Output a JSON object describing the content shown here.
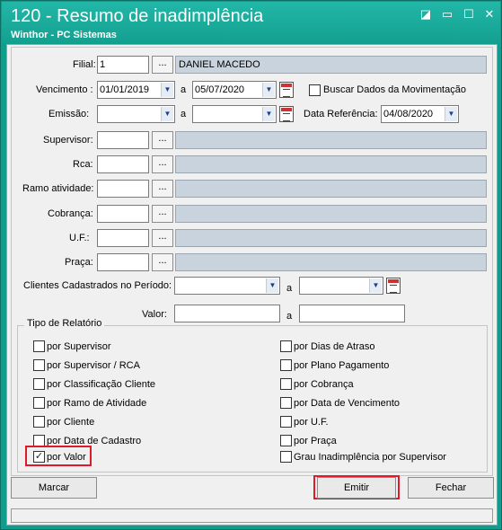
{
  "window": {
    "title": "120 - Resumo de inadimplência",
    "subtitle": "Winthor - PC Sistemas",
    "controls": {
      "help": "◪",
      "minimize": "▭",
      "maximize": "☐",
      "close": "✕"
    }
  },
  "form": {
    "filial": {
      "label": "Filial:",
      "value": "1",
      "lookup": "...",
      "name": "DANIEL MACEDO"
    },
    "vencimento": {
      "label": "Vencimento :",
      "from": "01/01/2019",
      "sep": "a",
      "to": "05/07/2020"
    },
    "buscar": {
      "label": "Buscar Dados da Movimentação",
      "checked": false
    },
    "emissao": {
      "label": "Emissão:",
      "from": "",
      "sep": "a",
      "to": ""
    },
    "data_referencia": {
      "label": "Data Referência:",
      "value": "04/08/2020"
    },
    "supervisor": {
      "label": "Supervisor:",
      "value": "",
      "lookup": "..."
    },
    "rca": {
      "label": "Rca:",
      "value": "",
      "lookup": "..."
    },
    "ramo": {
      "label": "Ramo atividade:",
      "value": "",
      "lookup": "..."
    },
    "cobranca": {
      "label": "Cobrança:",
      "value": "",
      "lookup": "..."
    },
    "uf": {
      "label": "U.F.:",
      "value": "",
      "lookup": "..."
    },
    "praca": {
      "label": "Praça:",
      "value": "",
      "lookup": "..."
    },
    "clientes_periodo": {
      "label": "Clientes Cadastrados no Período:",
      "from": "",
      "sep": "a",
      "to": ""
    },
    "valor": {
      "label": "Valor:",
      "from": "",
      "sep": "a",
      "to": ""
    }
  },
  "report_type": {
    "title": "Tipo de Relatório",
    "left": [
      {
        "label": "por Supervisor",
        "checked": false
      },
      {
        "label": "por Supervisor / RCA",
        "checked": false
      },
      {
        "label": "por Classificação Cliente",
        "checked": false
      },
      {
        "label": "por Ramo de Atividade",
        "checked": false
      },
      {
        "label": "por Cliente",
        "checked": false
      },
      {
        "label": "por Data de Cadastro",
        "checked": false
      },
      {
        "label": "por Valor",
        "checked": true
      }
    ],
    "right": [
      {
        "label": "por Dias de Atraso",
        "checked": false
      },
      {
        "label": "por Plano Pagamento",
        "checked": false
      },
      {
        "label": "por Cobrança",
        "checked": false
      },
      {
        "label": "por Data de Vencimento",
        "checked": false
      },
      {
        "label": "por U.F.",
        "checked": false
      },
      {
        "label": "por Praça",
        "checked": false
      },
      {
        "label": "Grau Inadimplência por Supervisor",
        "checked": false
      }
    ]
  },
  "buttons": {
    "marcar": "Marcar",
    "emitir": "Emitir",
    "fechar": "Fechar"
  },
  "colors": {
    "titlebar": "#14a090",
    "highlight": "#e0192c",
    "readonly": "#c8d3dd"
  }
}
